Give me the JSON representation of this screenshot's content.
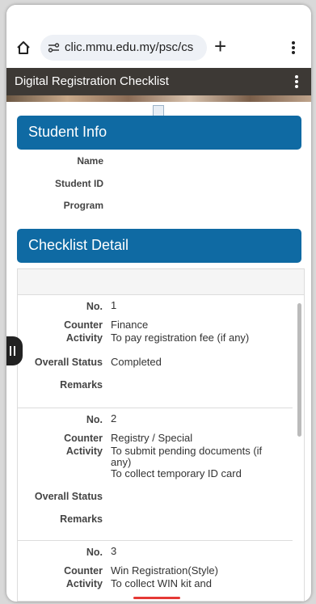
{
  "browser": {
    "url": "clic.mmu.edu.my/psc/cs"
  },
  "app": {
    "title": "Digital Registration Checklist"
  },
  "student_info": {
    "heading": "Student Info",
    "fields": [
      {
        "label": "Name"
      },
      {
        "label": "Student ID"
      },
      {
        "label": "Program"
      }
    ]
  },
  "checklist": {
    "heading": "Checklist Detail",
    "labels": {
      "no": "No.",
      "counter": "Counter",
      "activity": "Activity",
      "status": "Overall Status",
      "remarks": "Remarks"
    },
    "items": [
      {
        "no": "1",
        "counter": "Finance",
        "activity": "To pay registration fee (if any)",
        "status": "Completed",
        "remarks": ""
      },
      {
        "no": "2",
        "counter": "Registry / Special",
        "activity": "To submit pending documents (if any)\nTo collect temporary ID card",
        "status": "",
        "remarks": ""
      },
      {
        "no": "3",
        "counter": "Win Registration(Style)",
        "activity": "To collect WIN kit and",
        "status": "",
        "remarks": ""
      }
    ]
  }
}
